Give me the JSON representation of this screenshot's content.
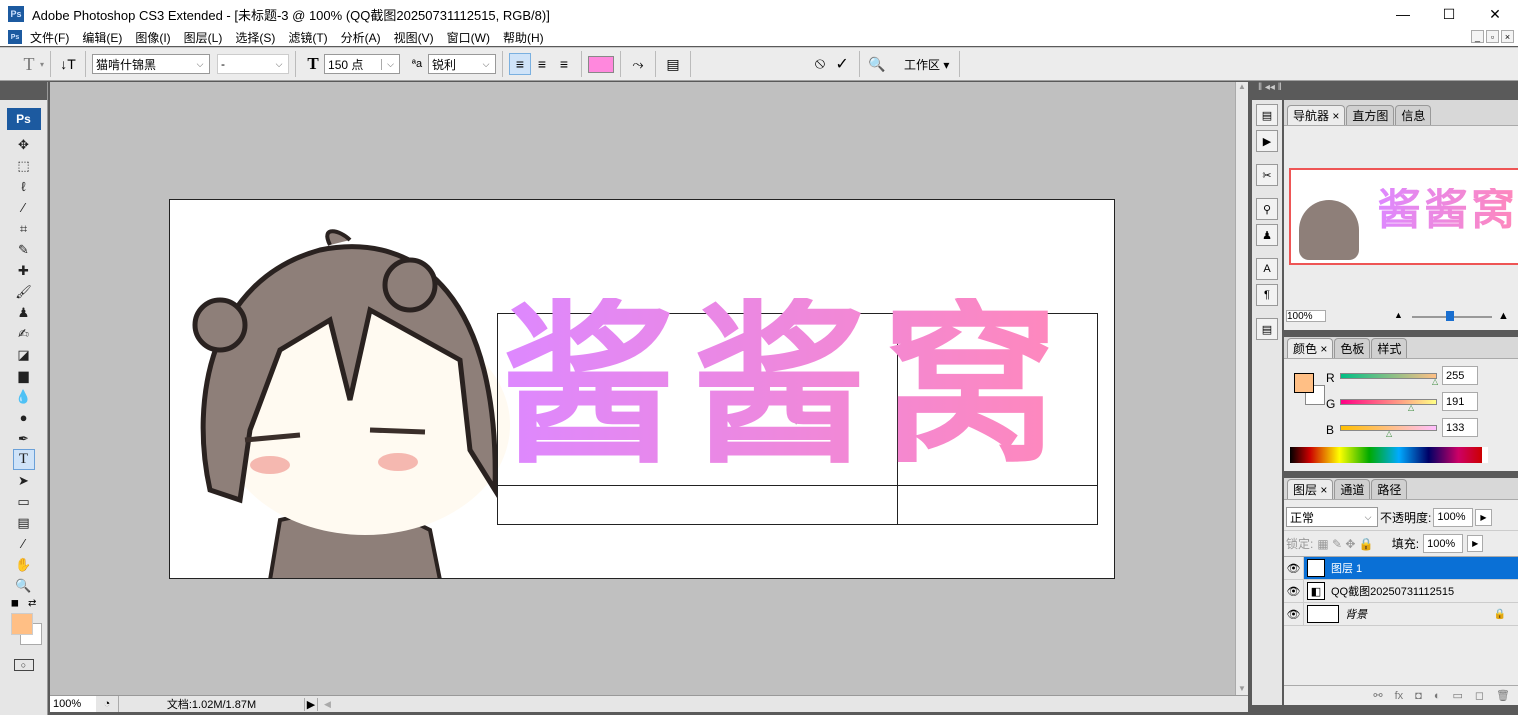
{
  "window": {
    "title": "Adobe Photoshop CS3 Extended - [未标题-3 @ 100% (QQ截图20250731112515, RGB/8)]",
    "app_icon": "Ps",
    "minimize": "—",
    "maximize": "☐",
    "close": "✕"
  },
  "menu": [
    "文件(F)",
    "编辑(E)",
    "图像(I)",
    "图层(L)",
    "选择(S)",
    "滤镜(T)",
    "分析(A)",
    "视图(V)",
    "窗口(W)",
    "帮助(H)"
  ],
  "options": {
    "font_family": "猫啃什锦黑",
    "font_style": "-",
    "font_size": "150 点",
    "antialias": "锐利",
    "text_color": "#ff88dd",
    "workspace": "工作区"
  },
  "toolbox": {
    "badge": "Ps",
    "foreground": "#ffbf85",
    "background": "#ffffff"
  },
  "canvas": {
    "text": "酱酱窝",
    "color_left": "#dd88ff",
    "color_right": "#ff88bb"
  },
  "status": {
    "zoom": "100%",
    "doc": "文档:1.02M/1.87M"
  },
  "navigator": {
    "tabs": [
      "导航器",
      "直方图",
      "信息"
    ],
    "zoom": "100%",
    "preview_text": "酱酱窝"
  },
  "color_panel": {
    "tabs": [
      "颜色",
      "色板",
      "样式"
    ],
    "r_label": "R",
    "g_label": "G",
    "b_label": "B",
    "r": "255",
    "g": "191",
    "b": "133",
    "fg": "#ffbf85"
  },
  "layers_panel": {
    "tabs": [
      "图层",
      "通道",
      "路径"
    ],
    "blend": "正常",
    "opacity_label": "不透明度:",
    "opacity": "100%",
    "lock_label": "锁定:",
    "fill_label": "填充:",
    "fill": "100%",
    "layers": [
      {
        "name": "图层 1",
        "type": "text",
        "selected": true
      },
      {
        "name": "QQ截图20250731112515",
        "type": "smart",
        "selected": false
      },
      {
        "name": "背景",
        "type": "background",
        "selected": false
      }
    ]
  }
}
